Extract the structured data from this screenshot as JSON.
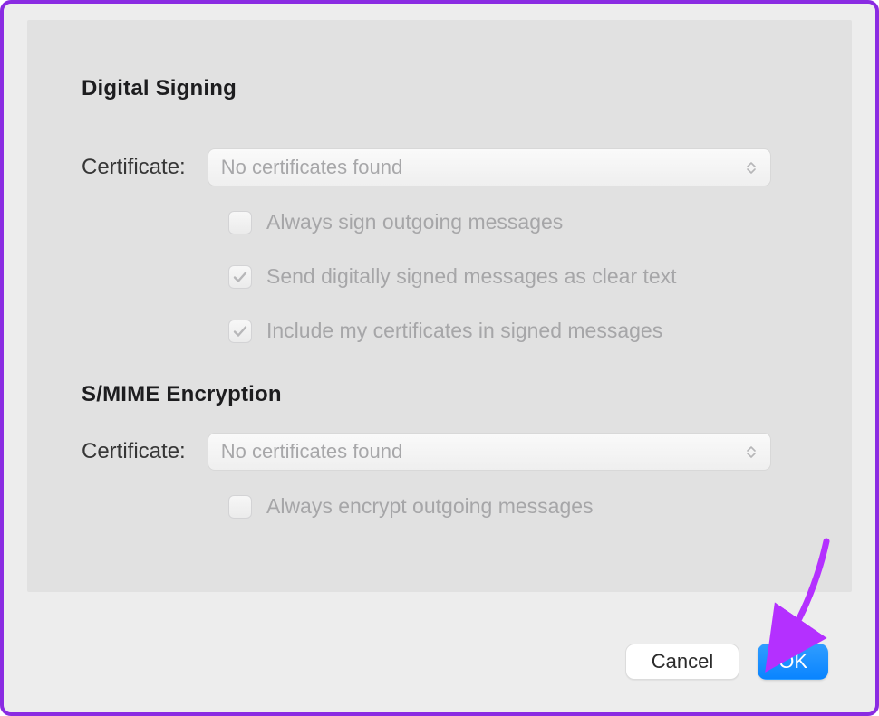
{
  "sections": {
    "signing": {
      "title": "Digital Signing",
      "certificate_label": "Certificate:",
      "certificate_placeholder": "No certificates found",
      "options": {
        "always_sign": {
          "label": "Always sign outgoing messages",
          "checked": false
        },
        "clear_text": {
          "label": "Send digitally signed messages as clear text",
          "checked": true
        },
        "include_certs": {
          "label": "Include my certificates in signed messages",
          "checked": true
        }
      }
    },
    "encryption": {
      "title": "S/MIME Encryption",
      "certificate_label": "Certificate:",
      "certificate_placeholder": "No certificates found",
      "options": {
        "always_encrypt": {
          "label": "Always encrypt outgoing messages",
          "checked": false
        }
      }
    }
  },
  "buttons": {
    "cancel": "Cancel",
    "ok": "OK"
  }
}
